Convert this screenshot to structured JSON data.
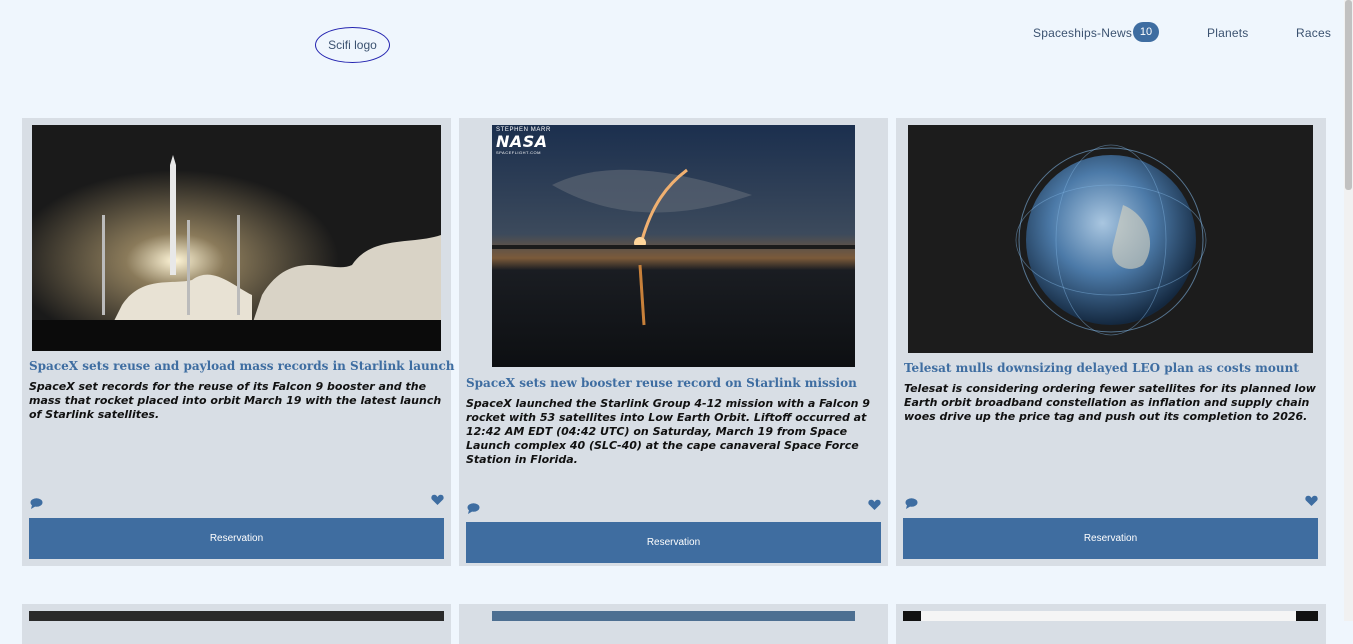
{
  "header": {
    "logo_label": "Scifi logo",
    "nav": [
      {
        "label": "Spaceships-News",
        "badge": "10"
      },
      {
        "label": "Planets"
      },
      {
        "label": "Races"
      }
    ]
  },
  "cards": [
    {
      "title": "SpaceX sets reuse and payload mass records in Starlink launch",
      "text": "SpaceX set records for the reuse of its Falcon 9 booster and the mass that rocket placed into orbit March 19 with the latest launch of Starlink satellites.",
      "button": "Reservation"
    },
    {
      "title": "SpaceX sets new booster reuse record on Starlink mission",
      "text": "SpaceX launched the Starlink Group 4-12 mission with a Falcon 9 rocket with 53 satellites into Low Earth Orbit. Liftoff occurred at 12:42 AM EDT (04:42 UTC) on Saturday, March 19 from Space Launch complex 40 (SLC-40) at the cape canaveral Space Force Station in Florida.",
      "button": "Reservation"
    },
    {
      "title": "Telesat mulls downsizing delayed LEO plan as costs mount",
      "text": "Telesat is considering ordering fewer satellites for its planned low Earth orbit broadband constellation as inflation and supply chain woes drive up the price tag and push out its completion to 2026.",
      "button": "Reservation"
    }
  ],
  "image_labels": {
    "nasa": "NASA",
    "photographer": "STEPHEN MARR",
    "site": "SPACEFLIGHT.COM"
  },
  "colors": {
    "accent": "#3e6da1",
    "background": "#eff6fd",
    "card": "#d8dee5"
  }
}
